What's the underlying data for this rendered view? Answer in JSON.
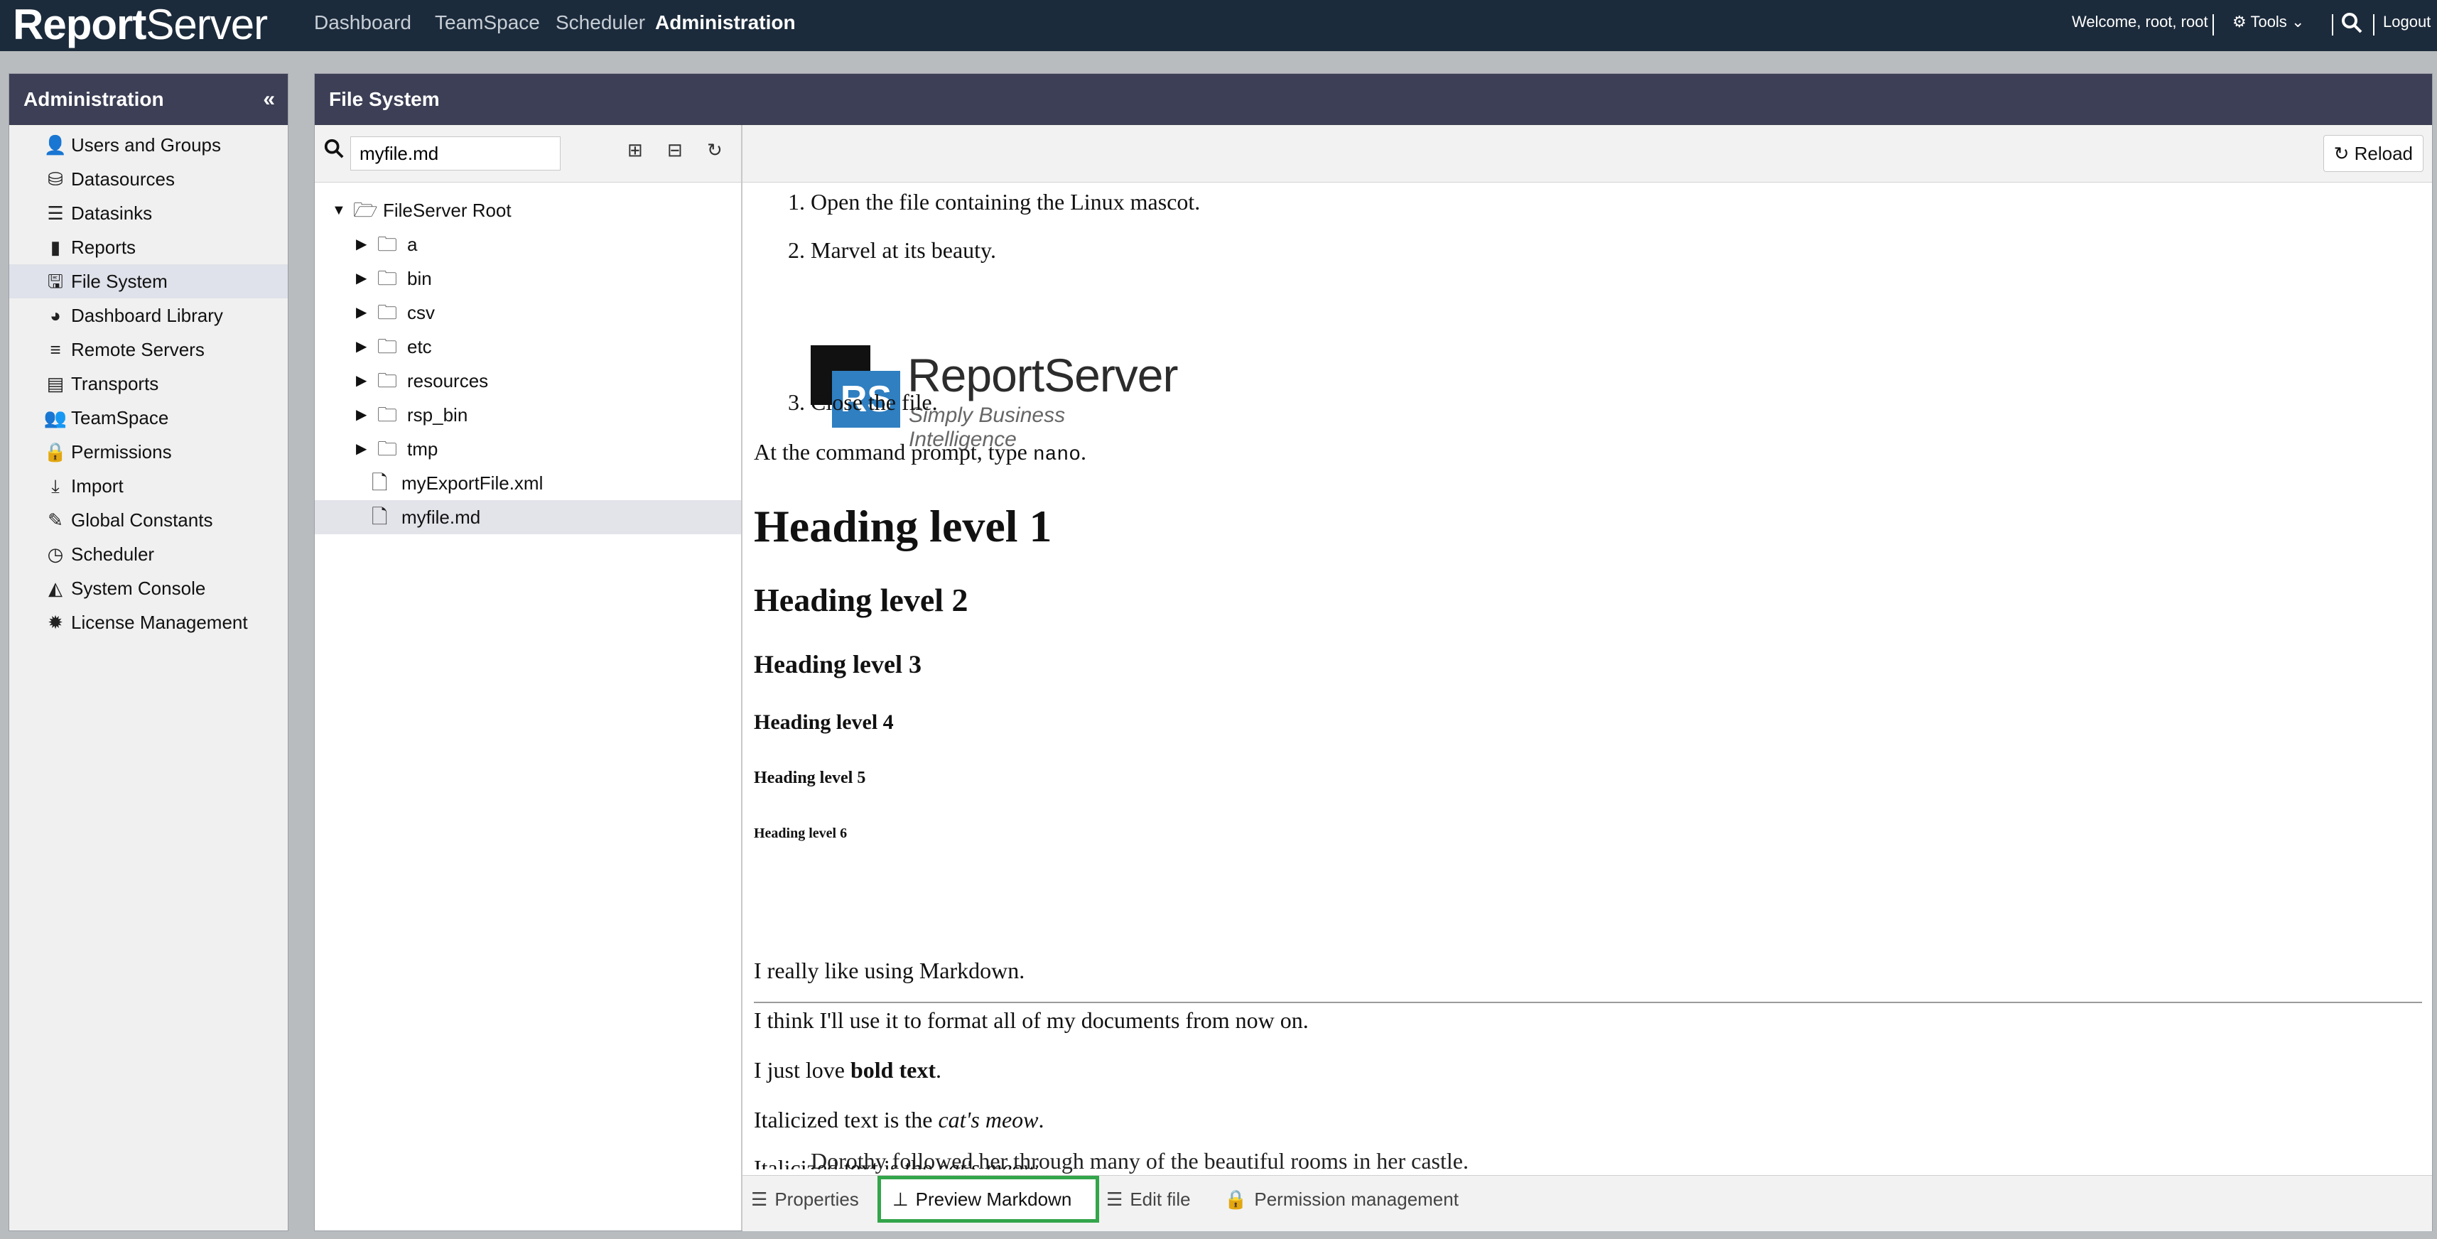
{
  "app": {
    "logo_bold": "Report",
    "logo_light": "Server",
    "nav": [
      "Dashboard",
      "TeamSpace",
      "Scheduler",
      "Administration"
    ],
    "active_nav": "Administration",
    "welcome": "Welcome, root, root",
    "tools_label": "Tools",
    "logout": "Logout"
  },
  "sidebar": {
    "title": "Administration",
    "items": [
      {
        "label": "Users and Groups",
        "icon": "user-icon"
      },
      {
        "label": "Datasources",
        "icon": "database-icon"
      },
      {
        "label": "Datasinks",
        "icon": "server-icon"
      },
      {
        "label": "Reports",
        "icon": "file-icon"
      },
      {
        "label": "File System",
        "icon": "floppy-icon"
      },
      {
        "label": "Dashboard Library",
        "icon": "dashboard-icon"
      },
      {
        "label": "Remote Servers",
        "icon": "remote-server-icon"
      },
      {
        "label": "Transports",
        "icon": "archive-icon"
      },
      {
        "label": "TeamSpace",
        "icon": "teamspace-icon"
      },
      {
        "label": "Permissions",
        "icon": "lock-icon"
      },
      {
        "label": "Import",
        "icon": "download-icon"
      },
      {
        "label": "Global Constants",
        "icon": "edit-icon"
      },
      {
        "label": "Scheduler",
        "icon": "clock-icon"
      },
      {
        "label": "System Console",
        "icon": "area-chart-icon"
      },
      {
        "label": "License Management",
        "icon": "certificate-icon"
      }
    ],
    "selected": "File System"
  },
  "filesystem": {
    "title": "File System",
    "search_value": "myfile.md",
    "root": "FileServer Root",
    "folders": [
      "a",
      "bin",
      "csv",
      "etc",
      "resources",
      "rsp_bin",
      "tmp"
    ],
    "files": [
      "myExportFile.xml",
      "myfile.md"
    ],
    "selected_file": "myfile.md"
  },
  "content": {
    "reload": "Reload",
    "ol_1": "Open the file containing the Linux mascot.",
    "ol_2": "Marvel at its beauty.",
    "ol_3": "Close the file.",
    "logo_badge": "RS",
    "logo_name": "ReportServer",
    "logo_tagline": "Simply Business Intelligence",
    "cmd_before": "At the command prompt, type ",
    "cmd_code": "nano",
    "cmd_after": ".",
    "h1": "Heading level 1",
    "h2": "Heading level 2",
    "h3": "Heading level 3",
    "h4": "Heading level 4",
    "h5": "Heading level 5",
    "h6": "Heading level 6",
    "p1": "I really like using Markdown.",
    "p2": "I think I'll use it to format all of my documents from now on.",
    "p3_before": "I just love ",
    "p3_bold": "bold text",
    "p3_after": ".",
    "p4_before": "Italicized text is the ",
    "p4_italic": "cat's meow",
    "p4_after": ".",
    "p5_before": "Italicized text is the ",
    "p5_italic": "cat's meow",
    "p5_after": ".",
    "quote": "Dorothy followed her through many of the beautiful rooms in her castle."
  },
  "tabs": [
    {
      "label": "Properties",
      "icon": "list-icon"
    },
    {
      "label": "Preview Markdown",
      "icon": "sitemap-icon"
    },
    {
      "label": "Edit file",
      "icon": "list-icon"
    },
    {
      "label": "Permission management",
      "icon": "lock-icon"
    }
  ],
  "active_tab": "Preview Markdown",
  "colors": {
    "topbar": "#1c2b3b",
    "panel_header": "#3c3f55",
    "active_tab_border": "#33a54a",
    "logo_blue": "#2f7fc1"
  }
}
